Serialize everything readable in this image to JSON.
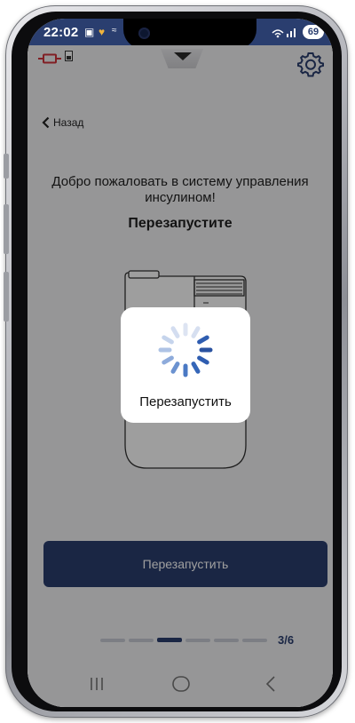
{
  "status_bar": {
    "time": "22:02",
    "battery": "69"
  },
  "nav": {
    "back_label": "Назад"
  },
  "content": {
    "welcome_text": "Добро пожаловать в систему управления инсулином!",
    "subtitle": "Перезапустите",
    "primary_button_label": "Перезапустить"
  },
  "progress": {
    "current_step": 3,
    "total_steps": 6,
    "step_label": "3/6"
  },
  "loading_modal": {
    "label": "Перезапустить"
  },
  "colors": {
    "primary": "#2a3e6f",
    "inactive_segment": "#c8ccd6",
    "spinner_blue": "#2f5db0"
  },
  "icons": {
    "settings": "gear-icon",
    "back": "chevron-left-icon",
    "pump": "pump-icon",
    "battery": "battery-icon",
    "nav_recents": "recents-icon",
    "nav_home": "home-icon",
    "nav_back": "back-icon"
  }
}
